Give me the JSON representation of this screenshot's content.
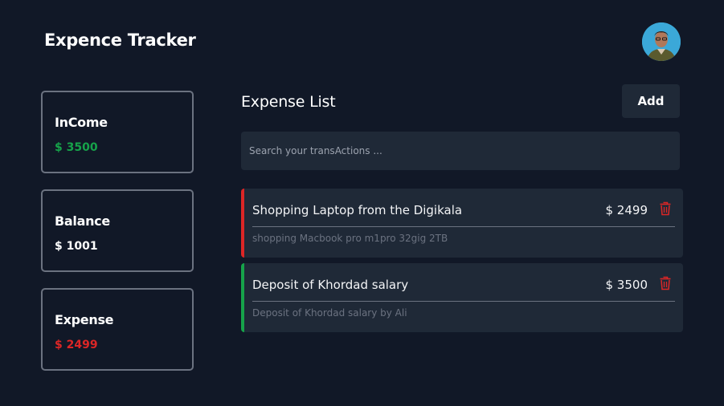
{
  "header": {
    "app_title": "Expence Tracker"
  },
  "summary": {
    "income": {
      "label": "InCome",
      "value": "$ 3500",
      "color": "#16a34a"
    },
    "balance": {
      "label": "Balance",
      "value": "$ 1001",
      "color": "#ffffff"
    },
    "expense": {
      "label": "Expense",
      "value": "$ 2499",
      "color": "#dc2626"
    }
  },
  "list": {
    "title": "Expense List",
    "add_label": "Add",
    "search_placeholder": "Search your transActions ...",
    "transactions": [
      {
        "title": "Shopping Laptop from the Digikala",
        "amount": "$ 2499",
        "description": "shopping Macbook pro m1pro 32gig 2TB",
        "type": "expense",
        "accent": "#dc2626"
      },
      {
        "title": "Deposit of Khordad salary",
        "amount": "$ 3500",
        "description": "Deposit of Khordad salary by Ali",
        "type": "income",
        "accent": "#16a34a"
      }
    ]
  },
  "icons": {
    "delete": "trash-icon",
    "avatar": "user-avatar"
  }
}
